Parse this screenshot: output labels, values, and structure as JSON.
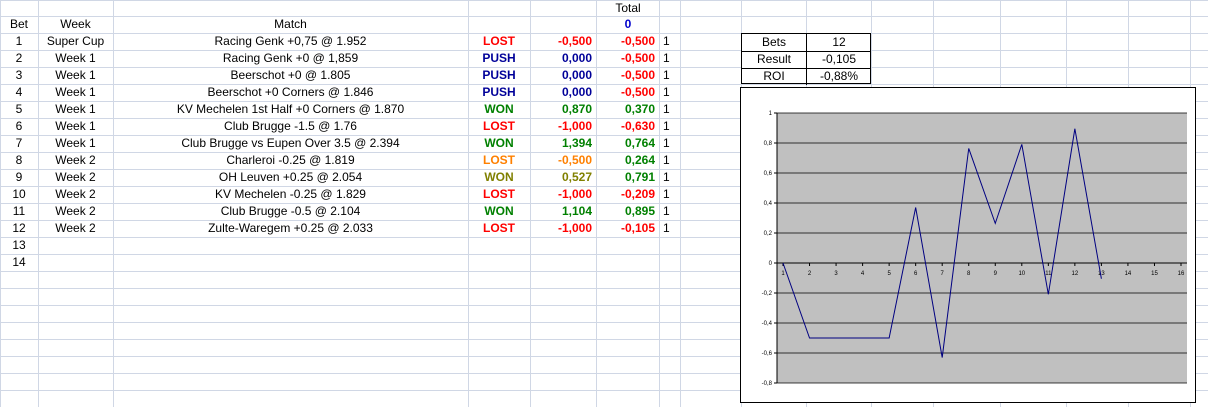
{
  "headers": {
    "bet": "Bet",
    "week": "Week",
    "match": "Match",
    "total_label": "Total",
    "total_value": "0"
  },
  "rows": [
    {
      "bet": "1",
      "week": "Super Cup",
      "match": "Racing Genk +0,75 @ 1.952",
      "status": "LOST",
      "result": "-0,500",
      "total": "-0,500",
      "flag": "1"
    },
    {
      "bet": "2",
      "week": "Week 1",
      "match": "Racing Genk +0 @ 1,859",
      "status": "PUSH",
      "result": "0,000",
      "total": "-0,500",
      "flag": "1"
    },
    {
      "bet": "3",
      "week": "Week 1",
      "match": "Beerschot +0 @ 1.805",
      "status": "PUSH",
      "result": "0,000",
      "total": "-0,500",
      "flag": "1"
    },
    {
      "bet": "4",
      "week": "Week 1",
      "match": "Beerschot +0 Corners @ 1.846",
      "status": "PUSH",
      "result": "0,000",
      "total": "-0,500",
      "flag": "1"
    },
    {
      "bet": "5",
      "week": "Week 1",
      "match": "KV Mechelen 1st Half +0 Corners @ 1.870",
      "status": "WON",
      "result": "0,870",
      "total": "0,370",
      "flag": "1"
    },
    {
      "bet": "6",
      "week": "Week 1",
      "match": "Club Brugge -1.5 @ 1.76",
      "status": "LOST",
      "result": "-1,000",
      "total": "-0,630",
      "flag": "1"
    },
    {
      "bet": "7",
      "week": "Week 1",
      "match": "Club Brugge vs Eupen Over 3.5 @ 2.394",
      "status": "WON",
      "result": "1,394",
      "total": "0,764",
      "flag": "1"
    },
    {
      "bet": "8",
      "week": "Week 2",
      "match": "Charleroi -0.25 @ 1.819",
      "status": "LOST",
      "result": "-0,500",
      "total": "0,264",
      "flag": "1",
      "half": true
    },
    {
      "bet": "9",
      "week": "Week 2",
      "match": "OH Leuven +0.25 @ 2.054",
      "status": "WON",
      "result": "0,527",
      "total": "0,791",
      "flag": "1",
      "half": true
    },
    {
      "bet": "10",
      "week": "Week 2",
      "match": "KV Mechelen -0.25 @ 1.829",
      "status": "LOST",
      "result": "-1,000",
      "total": "-0,209",
      "flag": "1"
    },
    {
      "bet": "11",
      "week": "Week 2",
      "match": "Club Brugge -0.5 @ 2.104",
      "status": "WON",
      "result": "1,104",
      "total": "0,895",
      "flag": "1"
    },
    {
      "bet": "12",
      "week": "Week 2",
      "match": "Zulte-Waregem +0.25 @ 2.033",
      "status": "LOST",
      "result": "-1,000",
      "total": "-0,105",
      "flag": "1"
    },
    {
      "bet": "13",
      "week": "",
      "match": "",
      "status": "",
      "result": "",
      "total": "",
      "flag": ""
    },
    {
      "bet": "14",
      "week": "",
      "match": "",
      "status": "",
      "result": "",
      "total": "",
      "flag": ""
    }
  ],
  "stats": {
    "bets_label": "Bets",
    "bets_value": "12",
    "result_label": "Result",
    "result_value": "-0,105",
    "roi_label": "ROI",
    "roi_value": "-0,88%"
  },
  "colors": {
    "lost": "#ff0000",
    "push": "#000099",
    "won": "#008000",
    "half_lost": "#ff8000",
    "half_won": "#808000",
    "total_neg": "#ff0000",
    "total_pos": "#008000",
    "chart_bg": "#c0c0c0",
    "chart_line": "#000080"
  },
  "chart_data": {
    "type": "line",
    "x": [
      1,
      2,
      3,
      4,
      5,
      6,
      7,
      8,
      9,
      10,
      11,
      12,
      13
    ],
    "series": [
      {
        "values": [
          0,
          -0.5,
          -0.5,
          -0.5,
          -0.5,
          0.37,
          -0.63,
          0.764,
          0.264,
          0.791,
          -0.209,
          0.895,
          -0.105
        ]
      }
    ],
    "xticks": [
      "1",
      "2",
      "3",
      "4",
      "5",
      "6",
      "7",
      "8",
      "9",
      "10",
      "11",
      "12",
      "13",
      "14",
      "15",
      "16"
    ],
    "yticks": [
      "1",
      "0,8",
      "0,6",
      "0,4",
      "0,2",
      "0",
      "-0,2",
      "-0,4",
      "-0,6",
      "-0,8"
    ],
    "ylim": [
      -0.8,
      1
    ],
    "xlim": [
      1,
      16
    ],
    "grid": true,
    "title": "",
    "xlabel": "",
    "ylabel": ""
  }
}
